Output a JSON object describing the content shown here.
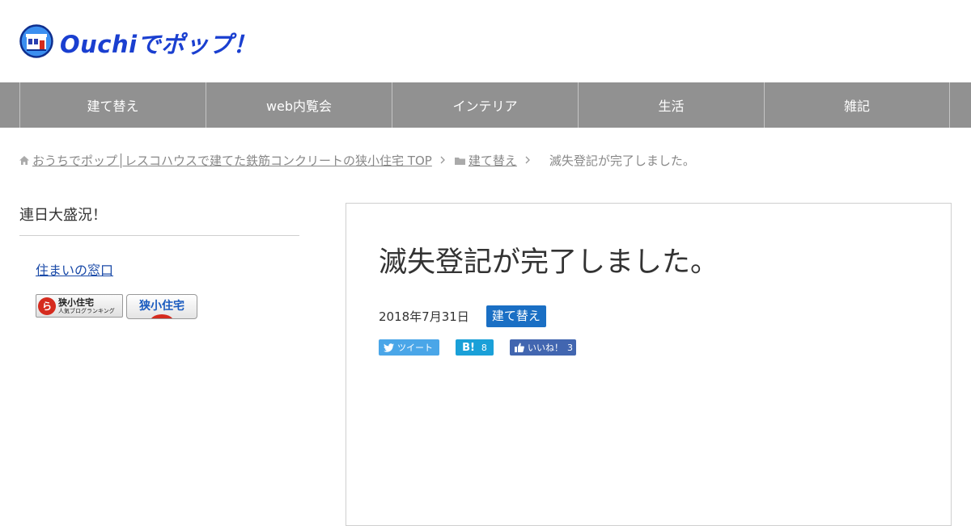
{
  "site": {
    "title": "Ouchiでポップ！",
    "logo_icon": "house-logo-icon"
  },
  "nav": {
    "items": [
      {
        "label": "建て替え"
      },
      {
        "label": "web内覧会"
      },
      {
        "label": "インテリア"
      },
      {
        "label": "生活"
      },
      {
        "label": "雑記"
      }
    ]
  },
  "breadcrumb": {
    "home_label": "おうちでポップ│レスコハウスで建てた鉄筋コンクリートの狭小住宅 TOP",
    "category_label": "建て替え",
    "current_label": "滅失登記が完了しました。"
  },
  "sidebar": {
    "widget_title": "連日大盛況！",
    "link_label": "住まいの窓口",
    "banner1_title": "狭小住宅",
    "banner1_subtitle": "人気ブログランキング",
    "banner1_mark": "ら",
    "banner2_title": "狭小住宅"
  },
  "article": {
    "title": "滅失登記が完了しました。",
    "date": "2018年7月31日",
    "category": "建て替え"
  },
  "share": {
    "tweet_label": "ツイート",
    "hatena_mark": "B!",
    "hatena_count": "8",
    "like_label": "いいね！",
    "like_count": "3"
  },
  "colors": {
    "nav_bg": "#919191",
    "logo_blue": "#1a3fd0",
    "category_badge": "#1a6fc4",
    "twitter": "#4aa6e8",
    "hatena": "#1aa0d8",
    "facebook": "#4266b0"
  }
}
